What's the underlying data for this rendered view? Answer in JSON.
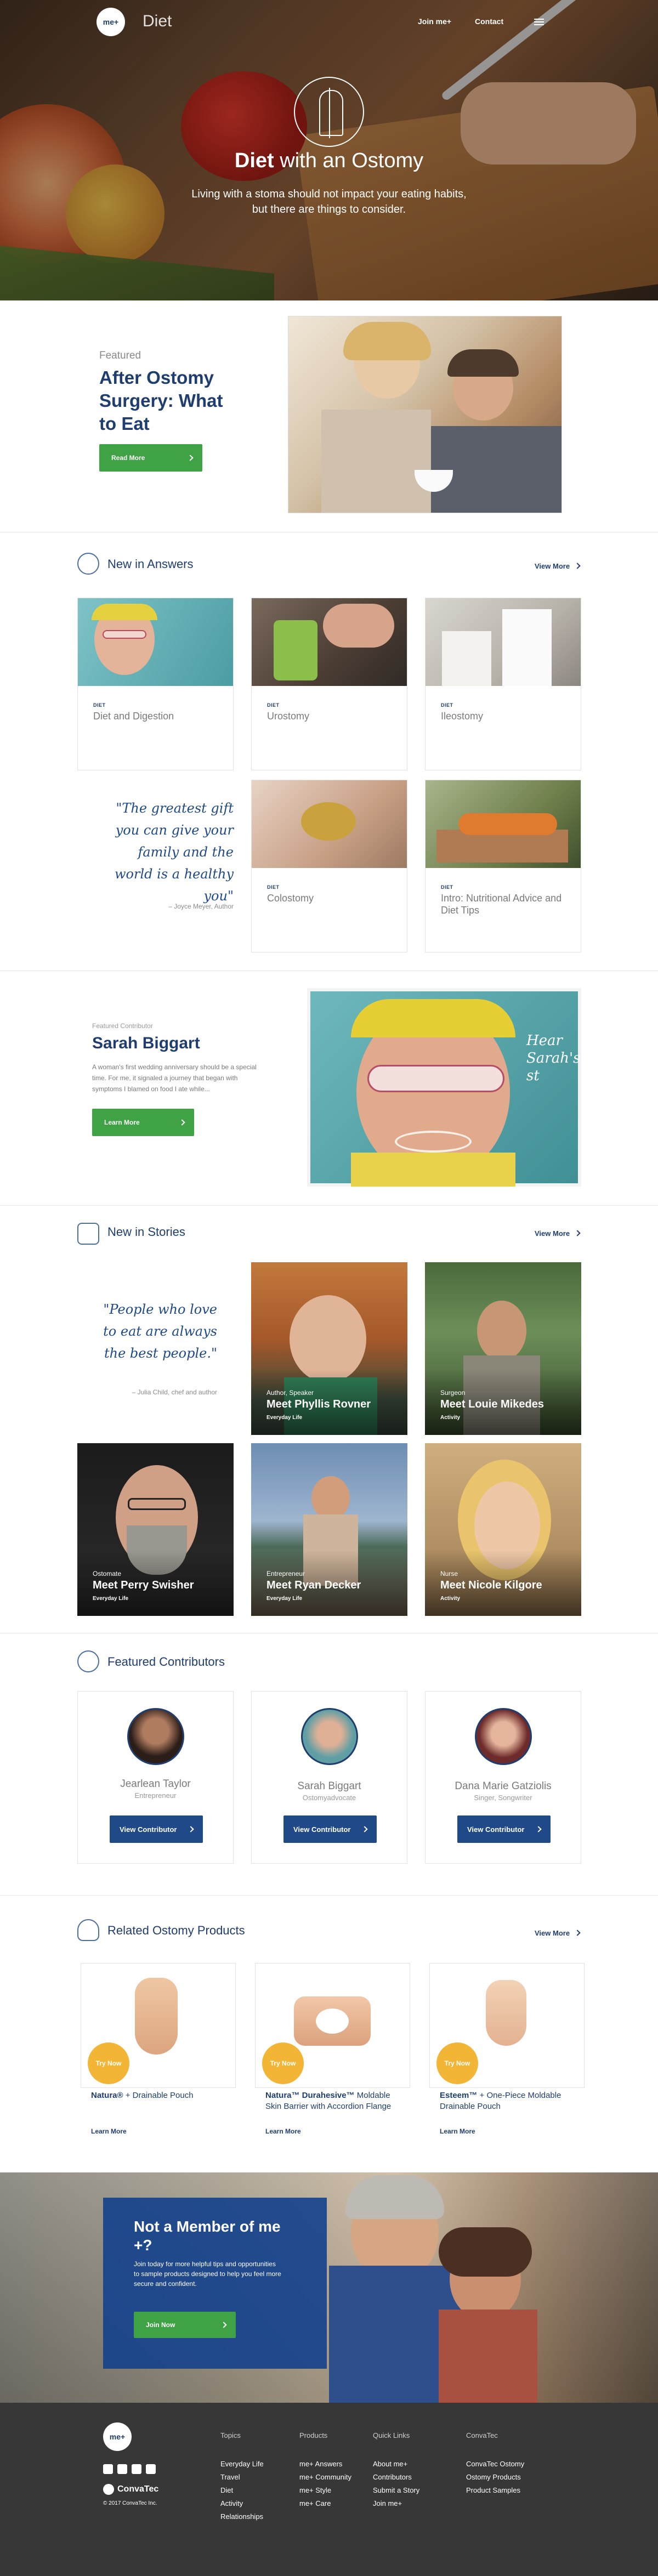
{
  "nav": {
    "logo": "me+",
    "brand": "Diet",
    "join": "Join me+",
    "contact": "Contact"
  },
  "hero": {
    "title_bold": "Diet",
    "title_rest": " with an Ostomy",
    "subtitle_line1": "Living with a stoma should not impact your eating habits,",
    "subtitle_line2": "but there are things to consider."
  },
  "featured": {
    "label": "Featured",
    "title": "After Ostomy Surgery: What to Eat",
    "button": "Read More"
  },
  "answers": {
    "heading": "New in Answers",
    "view_more": "View More",
    "cards": [
      {
        "category": "DIET",
        "title": "Diet and Digestion"
      },
      {
        "category": "DIET",
        "title": "Urostomy"
      },
      {
        "category": "DIET",
        "title": "Ileostomy"
      },
      {
        "category": "DIET",
        "title": "Colostomy"
      },
      {
        "category": "DIET",
        "title": "Intro: Nutritional Advice and Diet Tips"
      }
    ],
    "quote": "\"The greatest gift you can give your family and the world is a healthy you\"",
    "quote_by": "– Joyce Meyer, Author"
  },
  "contributor_feature": {
    "label": "Featured Contributor",
    "name": "Sarah Biggart",
    "body": "A woman's first wedding anniversary should be a special time. For me, it signaled a journey that began with symptoms I blamed on food I ate while...",
    "button": "Learn More",
    "photo_text": "Hear Sarah's st"
  },
  "stories": {
    "heading": "New in Stories",
    "view_more": "View More",
    "quote": "\"People who love to eat are always the best people.\"",
    "quote_by": "– Julia Child, chef and author",
    "items": [
      {
        "role": "Author, Speaker",
        "name": "Meet Phyllis Rovner",
        "tag": "Everyday Life"
      },
      {
        "role": "Surgeon",
        "name": "Meet Louie Mikedes",
        "tag": "Activity"
      },
      {
        "role": "Ostomate",
        "name": "Meet Perry Swisher",
        "tag": "Everyday Life"
      },
      {
        "role": "Entrepreneur",
        "name": "Meet Ryan Decker",
        "tag": "Everyday Life"
      },
      {
        "role": "Nurse",
        "name": "Meet Nicole Kilgore",
        "tag": "Activity"
      }
    ]
  },
  "contributors": {
    "heading": "Featured Contributors",
    "items": [
      {
        "name": "Jearlean Taylor",
        "role": "Entrepreneur",
        "button": "View Contributor"
      },
      {
        "name": "Sarah Biggart",
        "role": "Ostomyadvocate",
        "button": "View Contributor"
      },
      {
        "name": "Dana Marie Gatziolis",
        "role": "Singer, Songwriter",
        "button": "View Contributor"
      }
    ]
  },
  "products": {
    "heading": "Related Ostomy Products",
    "view_more": "View More",
    "items": [
      {
        "try": "Try Now",
        "name_bold": "Natura®",
        "name_rest": " + Drainable Pouch",
        "learn": "Learn More"
      },
      {
        "try": "Try Now",
        "name_bold": "Natura™ Durahesive™",
        "name_rest": " Moldable Skin Barrier with Accordion Flange",
        "learn": "Learn More"
      },
      {
        "try": "Try Now",
        "name_bold": "Esteem™",
        "name_rest": " + One-Piece Moldable Drainable Pouch",
        "learn": "Learn More"
      }
    ]
  },
  "member": {
    "title": "Not a Member of me +?",
    "body": "Join today for more helpful tips and opportunities to sample products designed to help you feel more secure and confident.",
    "button": "Join Now"
  },
  "footer": {
    "logo": "me+",
    "brand": "ConvaTec",
    "copyright": "© 2017 ConvaTec Inc.",
    "columns": [
      {
        "heading": "Topics",
        "links": [
          "Everyday Life",
          "Travel",
          "Diet",
          "Activity",
          "Relationships"
        ]
      },
      {
        "heading": "Products",
        "links": [
          "me+ Answers",
          "me+ Community",
          "me+ Style",
          "me+ Care"
        ]
      },
      {
        "heading": "Quick Links",
        "links": [
          "About me+",
          "Contributors",
          "Submit a Story",
          "Join me+"
        ]
      },
      {
        "heading": "ConvaTec",
        "links": [
          "ConvaTec Ostomy",
          "Ostomy Products",
          "Product Samples"
        ]
      }
    ]
  },
  "colors": {
    "navy": "#1f3d6e",
    "green": "#3fa244",
    "blue_button": "#1f4a87",
    "try_badge": "#f2b535",
    "footer": "#373737"
  },
  "icons": [
    "menu-icon",
    "lightbulb-icon",
    "people-icon",
    "badge-icon",
    "hand-icon",
    "facebook-icon",
    "twitter-icon",
    "instagram-icon",
    "youtube-icon"
  ]
}
